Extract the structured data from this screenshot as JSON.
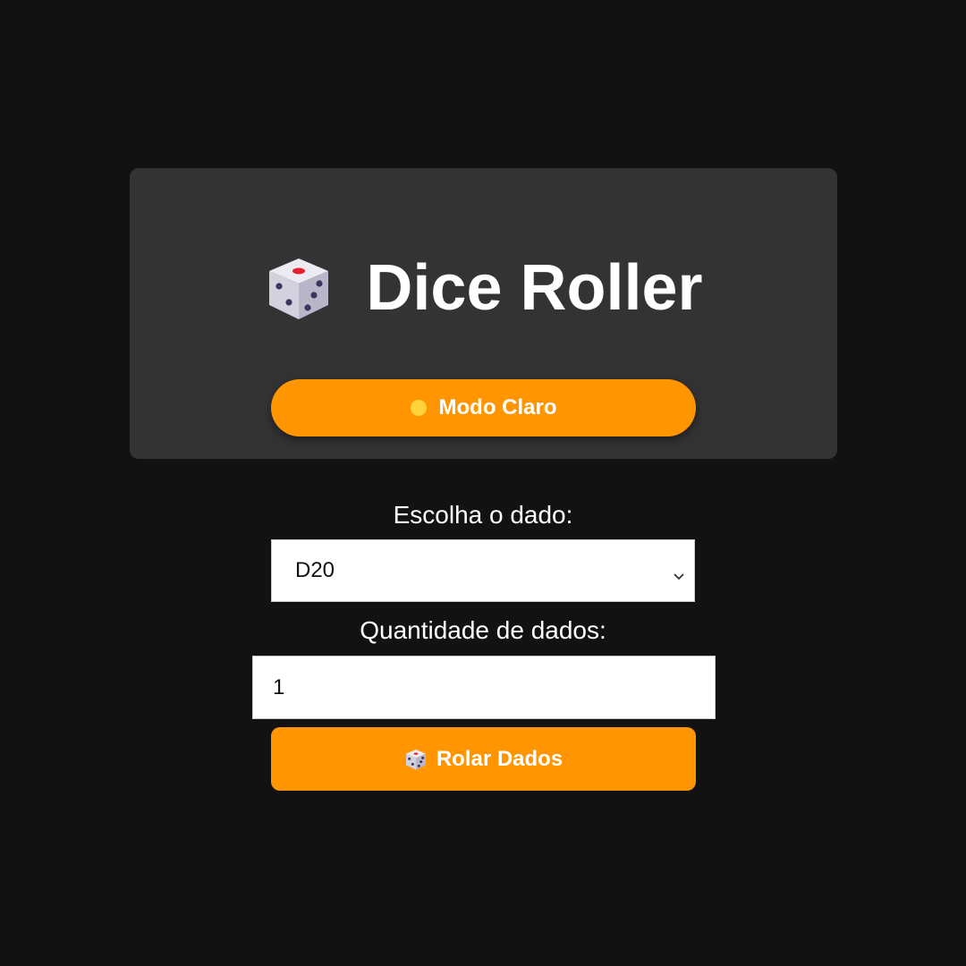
{
  "header": {
    "title": "Dice Roller",
    "icon": "die-icon",
    "theme_button_label": "Modo Claro",
    "theme_button_icon": "sun-icon"
  },
  "form": {
    "dice_label": "Escolha o dado:",
    "dice_selected": "D20",
    "quantity_label": "Quantidade de dados:",
    "quantity_value": "1",
    "roll_button_label": "Rolar Dados",
    "roll_button_icon": "die-icon"
  },
  "colors": {
    "background": "#121212",
    "card": "#333333",
    "accent": "#ff9500",
    "sun": "#ffd43b"
  }
}
